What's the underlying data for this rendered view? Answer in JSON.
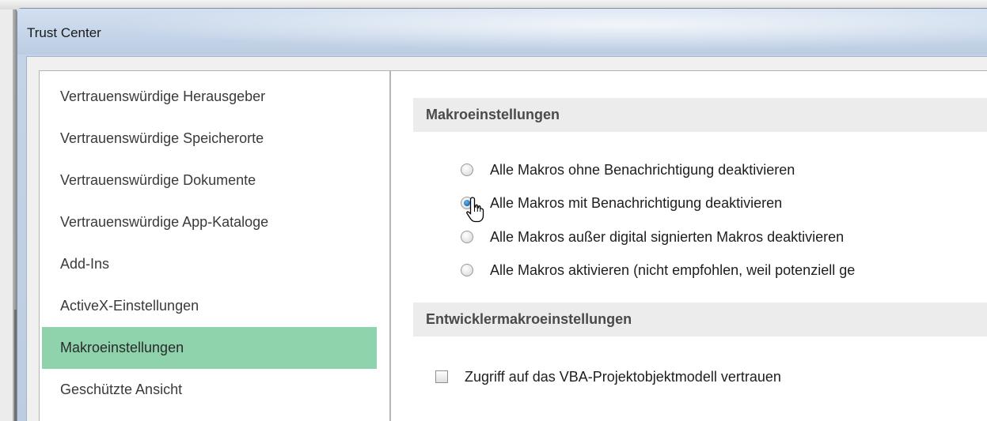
{
  "background_window": {
    "title_fragment": "Trust Center"
  },
  "dialog": {
    "title": "Trust Center"
  },
  "nav": {
    "items": [
      {
        "label": "Vertrauenswürdige Herausgeber",
        "selected": false
      },
      {
        "label": "Vertrauenswürdige Speicherorte",
        "selected": false
      },
      {
        "label": "Vertrauenswürdige Dokumente",
        "selected": false
      },
      {
        "label": "Vertrauenswürdige App-Kataloge",
        "selected": false
      },
      {
        "label": "Add-Ins",
        "selected": false
      },
      {
        "label": "ActiveX-Einstellungen",
        "selected": false
      },
      {
        "label": "Makroeinstellungen",
        "selected": true
      },
      {
        "label": "Geschützte Ansicht",
        "selected": false
      }
    ],
    "selected_color": "#8fd3ad"
  },
  "macro_settings": {
    "header": "Makroeinstellungen",
    "options": [
      {
        "label": "Alle Makros ohne Benachrichtigung deaktivieren",
        "checked": false
      },
      {
        "label": "Alle Makros mit Benachrichtigung deaktivieren",
        "checked": true
      },
      {
        "label": "Alle Makros außer digital signierten Makros deaktivieren",
        "checked": false
      },
      {
        "label": "Alle Makros aktivieren (nicht empfohlen, weil potenziell ge",
        "checked": false
      }
    ]
  },
  "developer_settings": {
    "header": "Entwicklermakroeinstellungen",
    "vba_checkbox": {
      "label": "Zugriff auf das VBA-Projektobjektmodell vertrauen",
      "checked": false
    }
  },
  "icons": {
    "cursor": "mouse-pointer-icon"
  }
}
